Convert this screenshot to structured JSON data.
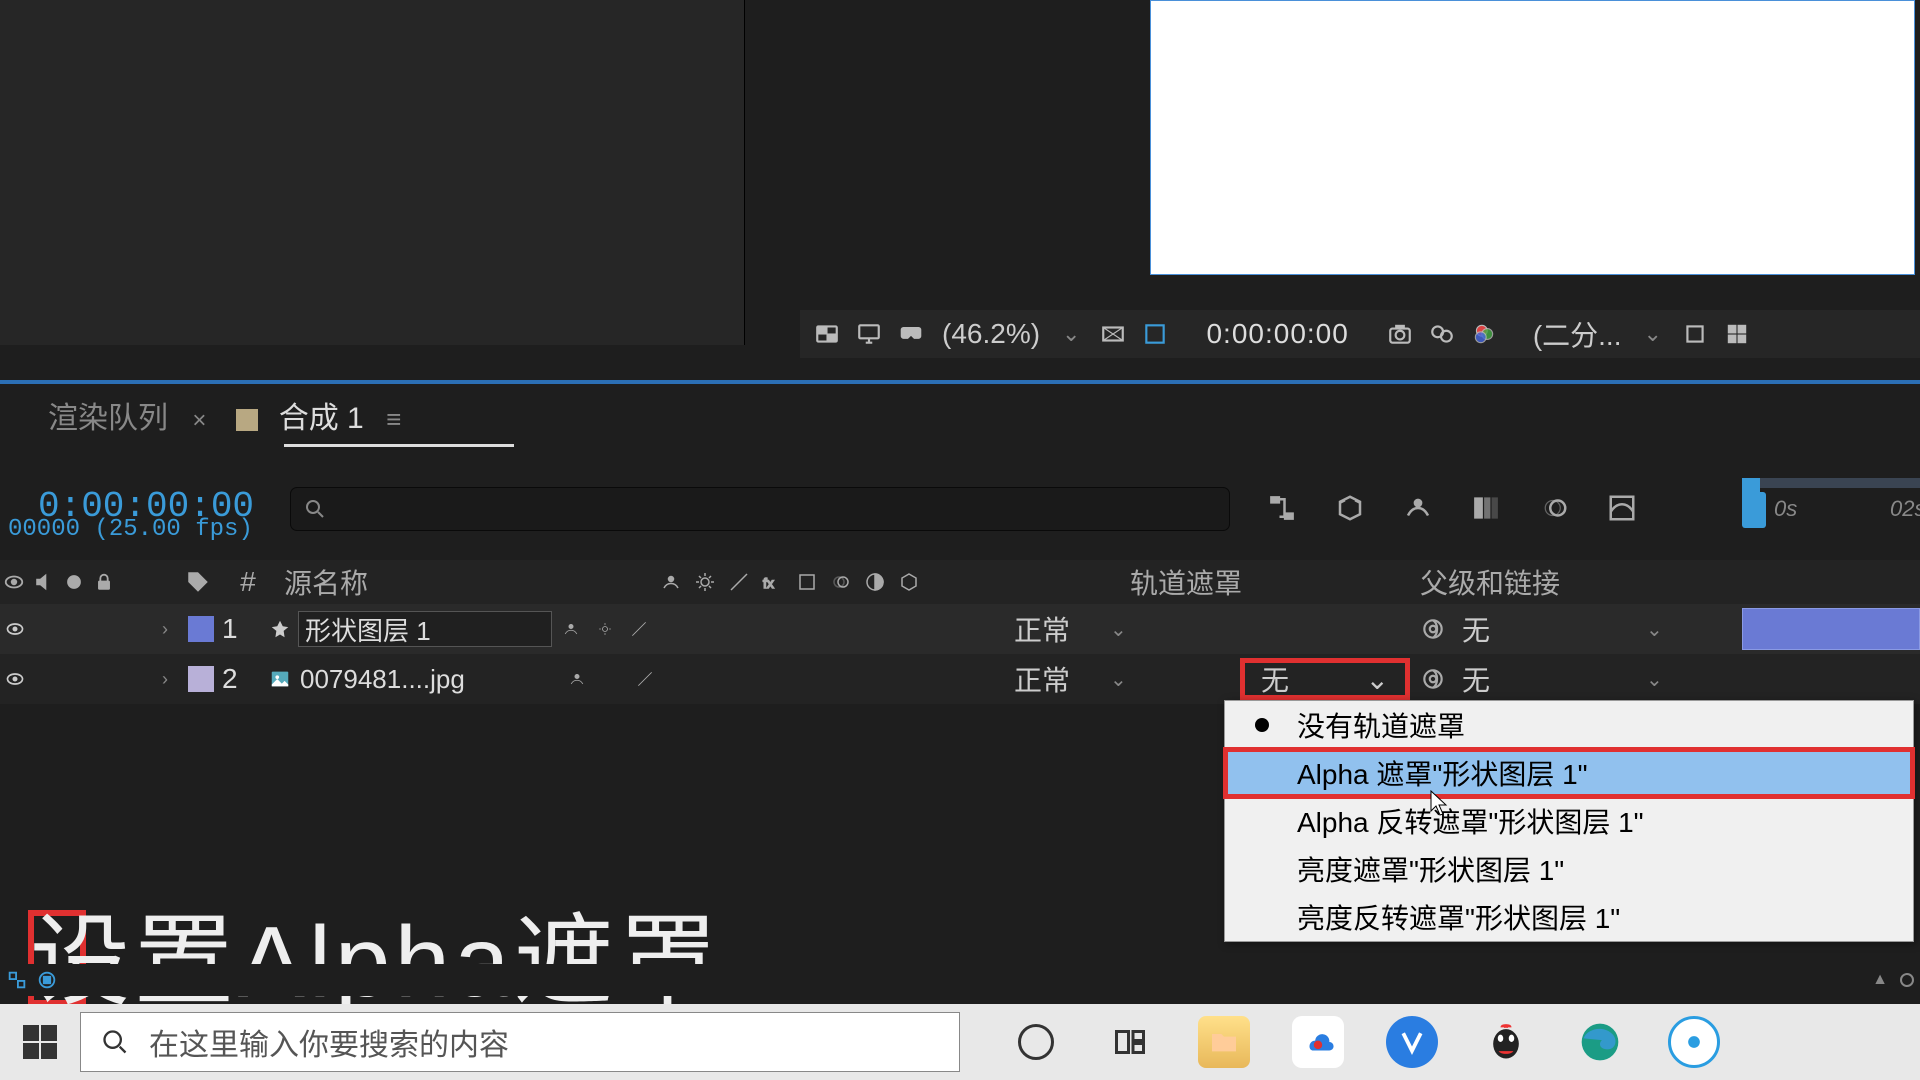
{
  "preview": {
    "zoom": "(46.2%)",
    "timecode": "0:00:00:00",
    "resolution": "(二分..."
  },
  "tabs": {
    "render_queue": "渲染队列",
    "comp": "合成 1"
  },
  "timeline": {
    "timecode": "0:00:00:00",
    "fps_line": "00000 (25.00 fps)",
    "ruler_0s": "0s",
    "ruler_02s": "02s"
  },
  "headers": {
    "hash": "#",
    "source_name": "源名称",
    "track_matte": "轨道遮罩",
    "parent": "父级和链接"
  },
  "layers": [
    {
      "num": "1",
      "name": "形状图层 1",
      "mode": "正常",
      "parent": "无"
    },
    {
      "num": "2",
      "name": "0079481....jpg",
      "mode": "正常",
      "trkmat": "无",
      "parent": "无"
    }
  ],
  "dropdown": {
    "none": "没有轨道遮罩",
    "alpha": "Alpha 遮罩\"形状图层 1\"",
    "alpha_inv": "Alpha 反转遮罩\"形状图层 1\"",
    "luma": "亮度遮罩\"形状图层 1\"",
    "luma_inv": "亮度反转遮罩\"形状图层 1\""
  },
  "tutorial": "设置Alpha遮罩",
  "taskbar": {
    "search_placeholder": "在这里输入你要搜索的内容"
  }
}
